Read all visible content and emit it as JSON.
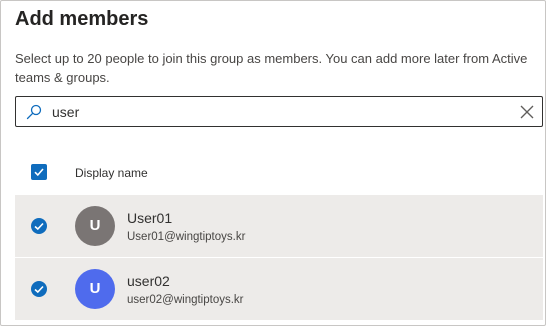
{
  "dialog": {
    "title": "Add members",
    "description": "Select up to 20 people to join this group as members. You can add more later from Active teams & groups."
  },
  "search": {
    "value": "user",
    "placeholder": "",
    "icon": "search-icon",
    "clear_icon": "close-icon"
  },
  "table": {
    "column_header": "Display name",
    "select_all_checked": true,
    "rows": [
      {
        "initial": "U",
        "name": "User01",
        "email": "User01@wingtiptoys.kr",
        "selected": true,
        "avatar_color": "#7a7574"
      },
      {
        "initial": "U",
        "name": "user02",
        "email": "user02@wingtiptoys.kr",
        "selected": true,
        "avatar_color": "#4f6bed"
      }
    ]
  },
  "colors": {
    "accent": "#0f6cbd",
    "row_selected_bg": "#edebe9"
  }
}
